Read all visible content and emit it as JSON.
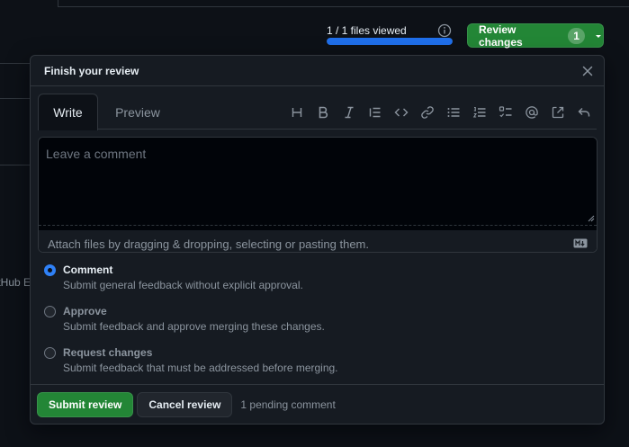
{
  "background": {
    "fragment_text": "GitHub E"
  },
  "header": {
    "files_viewed_text": "1 / 1 files viewed",
    "files_viewed_progress": 1.0,
    "review_button_label": "Review changes",
    "review_button_count": "1"
  },
  "panel": {
    "title": "Finish your review",
    "tabs": [
      {
        "label": "Write",
        "active": true
      },
      {
        "label": "Preview",
        "active": false
      }
    ],
    "toolbar_icons": [
      "heading-icon",
      "bold-icon",
      "italic-icon",
      "quote-icon",
      "code-icon",
      "link-icon",
      "unordered-list-icon",
      "ordered-list-icon",
      "task-list-icon",
      "mention-icon",
      "cross-reference-icon",
      "saved-reply-icon"
    ],
    "comment_placeholder": "Leave a comment",
    "comment_value": "",
    "attach_text": "Attach files by dragging & dropping, selecting or pasting them.",
    "options": [
      {
        "label": "Comment",
        "description": "Submit general feedback without explicit approval.",
        "checked": true
      },
      {
        "label": "Approve",
        "description": "Submit feedback and approve merging these changes.",
        "checked": false
      },
      {
        "label": "Request changes",
        "description": "Submit feedback that must be addressed before merging.",
        "checked": false
      }
    ],
    "submit_label": "Submit review",
    "cancel_label": "Cancel review",
    "pending_text": "1 pending comment"
  },
  "colors": {
    "background": "#0d1117",
    "panel": "#161b22",
    "border": "#30363d",
    "primary_green": "#238636",
    "accent_blue": "#2f81f7",
    "progress_blue": "#1f6feb"
  }
}
